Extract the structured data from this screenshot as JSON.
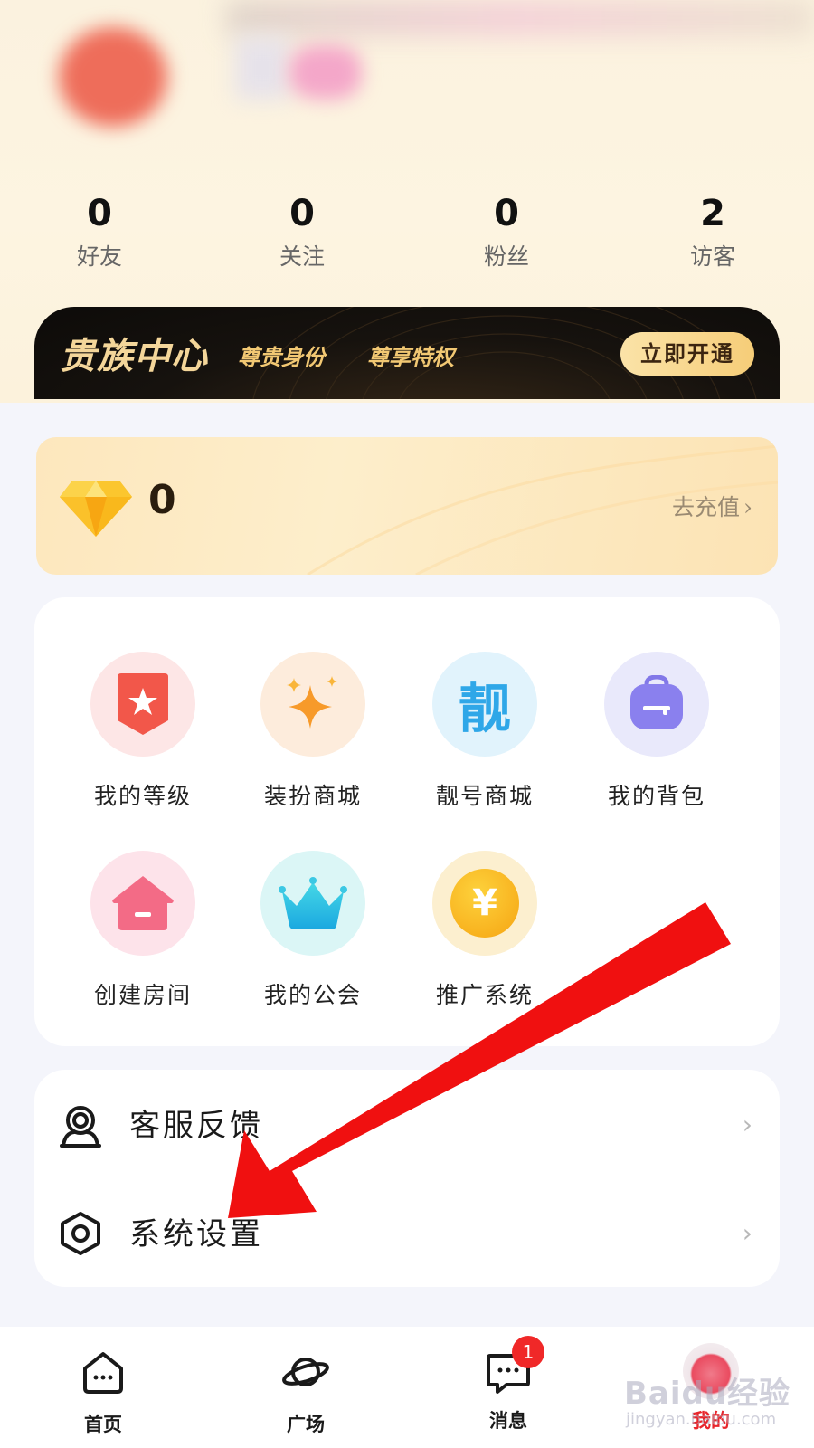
{
  "stats": [
    {
      "value": "0",
      "label": "好友"
    },
    {
      "value": "0",
      "label": "关注"
    },
    {
      "value": "0",
      "label": "粉丝"
    },
    {
      "value": "2",
      "label": "访客"
    }
  ],
  "vip": {
    "title": "贵族中心",
    "tag1": "尊贵身份",
    "tag2": "尊享特权",
    "button": "立即开通"
  },
  "wallet": {
    "diamond_count": "0",
    "recharge_label": "去充值",
    "icon": "diamond-icon"
  },
  "grid": [
    {
      "label": "我的等级",
      "icon": "level-badge-icon",
      "bg": "#fde6e6"
    },
    {
      "label": "装扮商城",
      "icon": "sparkle-star-icon",
      "bg": "#fdecdc"
    },
    {
      "label": "靓号商城",
      "icon": "liang-char-icon",
      "bg": "#e1f3fc",
      "glyph": "靓"
    },
    {
      "label": "我的背包",
      "icon": "backpack-icon",
      "bg": "#e9e9fb"
    },
    {
      "label": "创建房间",
      "icon": "house-icon",
      "bg": "#fde3ea"
    },
    {
      "label": "我的公会",
      "icon": "crown-icon",
      "bg": "#dbf6f6"
    },
    {
      "label": "推广系统",
      "icon": "yuan-coin-icon",
      "bg": "#fcefcf",
      "glyph": "¥"
    }
  ],
  "list": [
    {
      "label": "客服反馈",
      "icon": "customer-service-icon"
    },
    {
      "label": "系统设置",
      "icon": "settings-hexagon-icon"
    }
  ],
  "tabs": [
    {
      "label": "首页",
      "icon": "home-icon"
    },
    {
      "label": "广场",
      "icon": "planet-icon"
    },
    {
      "label": "消息",
      "icon": "message-icon",
      "badge": "1"
    },
    {
      "label": "我的",
      "icon": "avatar-icon",
      "active": true
    }
  ],
  "watermark": {
    "main": "Baidu经验",
    "sub": "jingyan.baidu.com"
  },
  "colors": {
    "accent_red": "#e8262c",
    "vip_gold": "#f4d69a",
    "annotation_arrow": "#f01010"
  }
}
